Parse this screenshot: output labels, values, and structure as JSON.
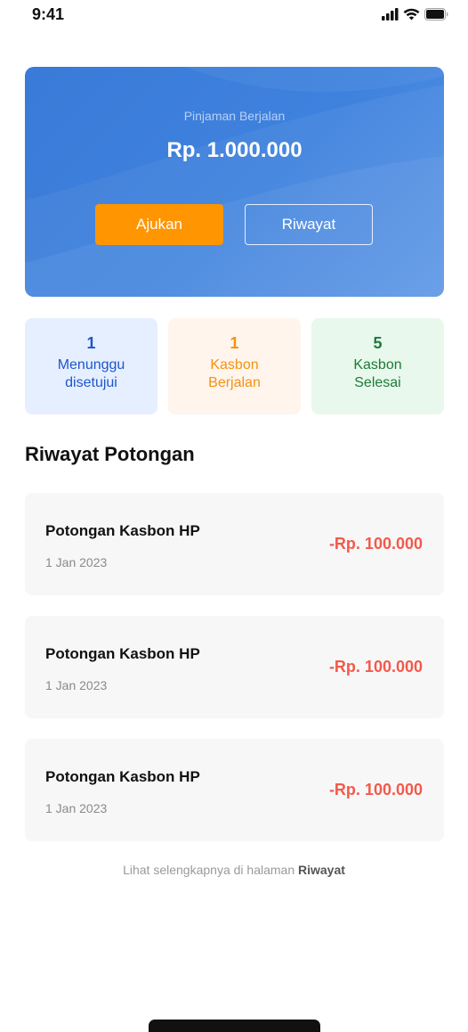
{
  "status_bar": {
    "time": "9:41",
    "icons": [
      "signal-icon",
      "wifi-icon",
      "battery-icon"
    ]
  },
  "hero": {
    "label": "Pinjaman Berjalan",
    "amount": "Rp. 1.000.000",
    "primary_button": "Ajukan",
    "secondary_button": "Riwayat"
  },
  "stats": [
    {
      "count": "1",
      "line1": "Menunggu",
      "line2": "disetujui",
      "color": "#1e56c8"
    },
    {
      "count": "1",
      "line1": "Kasbon",
      "line2": "Berjalan",
      "color": "#f39212"
    },
    {
      "count": "5",
      "line1": "Kasbon",
      "line2": "Selesai",
      "color": "#1f7a3a"
    }
  ],
  "history": {
    "title": "Riwayat Potongan",
    "items": [
      {
        "title": "Potongan Kasbon HP",
        "date": "1 Jan 2023",
        "amount": "-Rp. 100.000"
      },
      {
        "title": "Potongan Kasbon HP",
        "date": "1 Jan 2023",
        "amount": "-Rp. 100.000"
      },
      {
        "title": "Potongan Kasbon HP",
        "date": "1 Jan 2023",
        "amount": "-Rp. 100.000"
      }
    ],
    "footer_prefix": "Lihat selengkapnya di halaman ",
    "footer_link": "Riwayat"
  },
  "colors": {
    "primary": "#3f82de",
    "accent": "#ff9500",
    "negative": "#f25a4b"
  }
}
